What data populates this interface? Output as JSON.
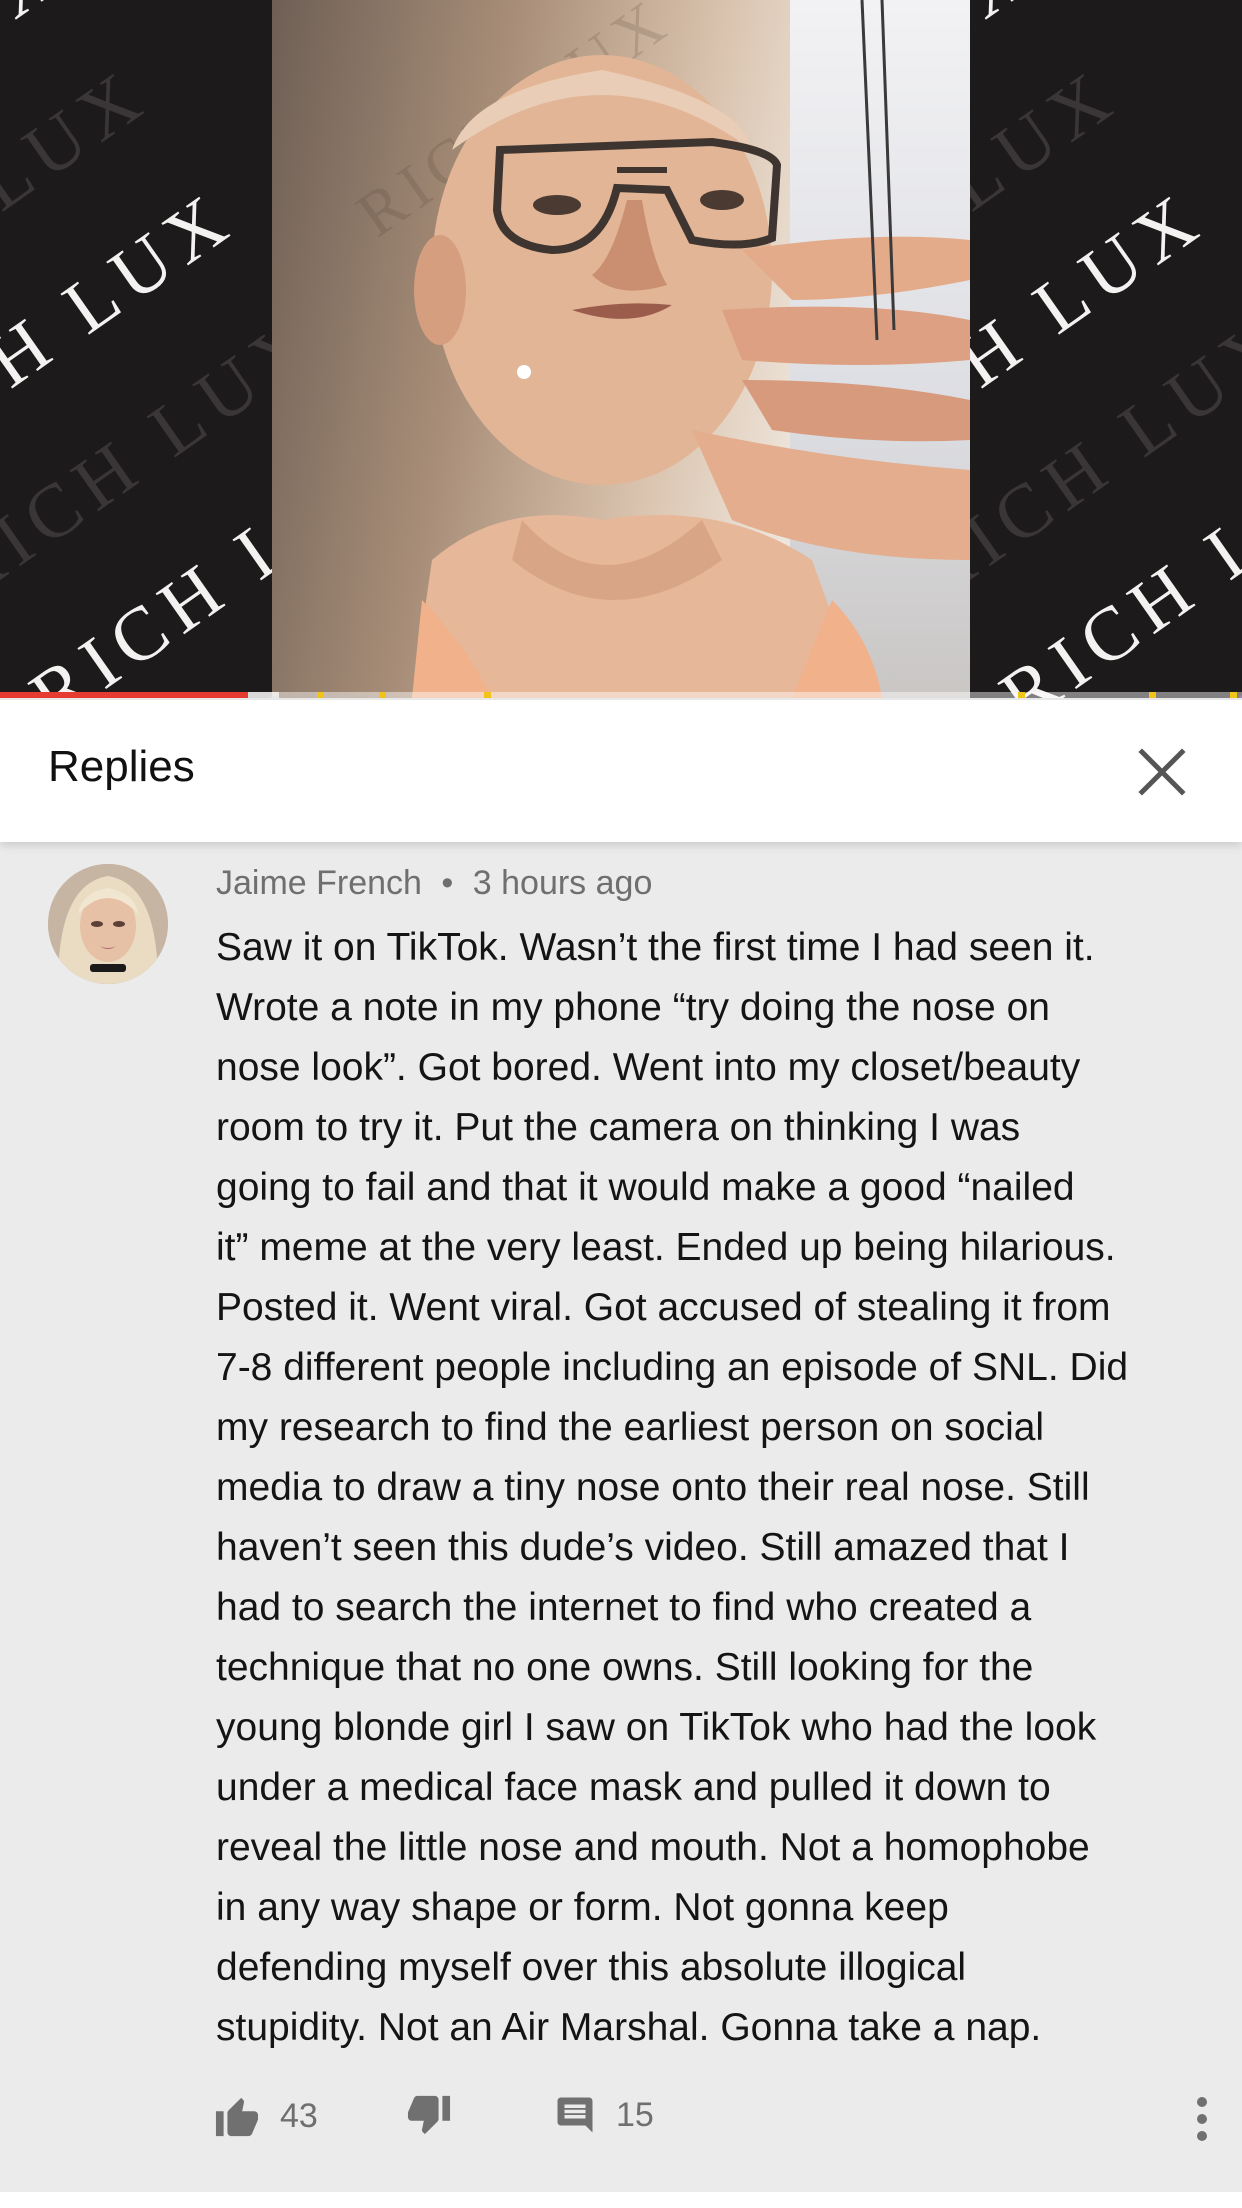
{
  "video": {
    "watermark_text": "RICH LUX",
    "progress_played_fraction": 0.2,
    "progress_buffered_fraction": 0.225,
    "ad_marker_fractions": [
      0.255,
      0.305,
      0.39,
      0.82,
      0.925,
      0.99
    ]
  },
  "header": {
    "title": "Replies",
    "close_icon": "close-icon"
  },
  "comment": {
    "author": "Jaime French",
    "separator": "•",
    "time": "3 hours ago",
    "avatar_icon": "user-avatar",
    "lines": [
      "Saw it on TikTok. Wasn’t the first time I had seen it.",
      "Wrote a note in my phone “try doing the nose on",
      "nose look”. Got bored. Went into my closet/beauty",
      "room to try it. Put the camera on thinking I was",
      "going to fail and that it would make a good “nailed",
      "it” meme at the very least. Ended up being hilarious.",
      "Posted it. Went viral. Got accused of stealing it from",
      "7-8 different people including an episode of SNL. Did",
      "my research to find the earliest person on social",
      "media to draw a tiny nose onto their real nose. Still",
      "haven’t seen this dude’s video. Still amazed that I",
      "had to search the internet to find who created a",
      "technique that no one owns. Still looking for the",
      "young blonde girl I saw on TikTok who had the look",
      "under a medical face mask and pulled it down to",
      "reveal the little nose and mouth. Not a homophobe",
      "in any way shape or form. Not gonna keep",
      "defending myself over this absolute illogical",
      "stupidity. Not an Air Marshal. Gonna take a nap."
    ],
    "likes": "43",
    "replies": "15"
  },
  "colors": {
    "progress_played": "#e53b30",
    "ad_marker": "#f0c419",
    "meta_text": "#6f6f6f",
    "background": "#ebebeb"
  }
}
